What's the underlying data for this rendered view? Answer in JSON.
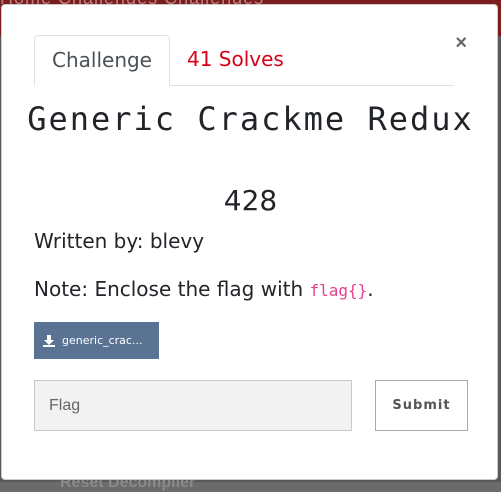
{
  "background": {
    "nav_text": "Home  Challenges  Challenges",
    "footer_text": "Reset         Decompiler"
  },
  "modal": {
    "close_label": "×",
    "tabs": [
      {
        "label": "Challenge",
        "active": true
      },
      {
        "label": "41 Solves",
        "active": false
      }
    ],
    "title": "Generic Crackme Redux",
    "value": "428",
    "author": "Written by: blevy",
    "note_prefix": "Note: Enclose the flag with ",
    "note_code": "flag{}",
    "note_suffix": ".",
    "file_button_label": "generic_crac...",
    "flag_placeholder": "Flag",
    "flag_value": "",
    "submit_label": "Submit"
  },
  "colors": {
    "accent": "#d9001b",
    "file_button": "#5a7393",
    "code": "#e83e8c",
    "topbar": "#7c1d1d"
  }
}
